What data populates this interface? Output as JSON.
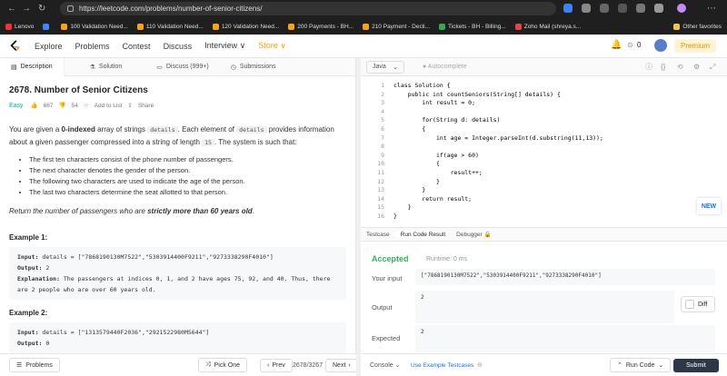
{
  "browser": {
    "url": "https://leetcode.com/problems/number-of-senior-citizens/",
    "bookmarks": [
      "Lenovo",
      "100 Validation Need...",
      "110 Validation Need...",
      "120 Validation Need...",
      "200 Payments - BH...",
      "210 Payment - Decli...",
      "Tickets - BH - Billing...",
      "Zoho Mail (shreya.s..."
    ],
    "other_favorites": "Other favorites"
  },
  "nav": {
    "items": [
      "Explore",
      "Problems",
      "Contest",
      "Discuss",
      "Interview ∨",
      "Store ∨"
    ],
    "coins": "0",
    "premium": "Premium"
  },
  "left_tabs": [
    "Description",
    "Solution",
    "Discuss (999+)",
    "Submissions"
  ],
  "problem": {
    "title": "2678. Number of Senior Citizens",
    "difficulty": "Easy",
    "likes": "667",
    "dislikes": "54",
    "add_to_list": "Add to List",
    "share": "Share",
    "p1_a": "You are given a ",
    "p1_b": "0-indexed",
    "p1_c": " array of strings ",
    "p1_d": "details",
    "p1_e": ". Each element of ",
    "p1_f": "details",
    "p1_g": " provides information about a given passenger compressed into a string of length ",
    "p1_h": "15",
    "p1_i": ". The system is such that:",
    "bullets": [
      "The first ten characters consist of the phone number of passengers.",
      "The next character denotes the gender of the person.",
      "The following two characters are used to indicate the age of the person.",
      "The last two characters determine the seat allotted to that person."
    ],
    "p2_a": "Return the number of passengers who are ",
    "p2_b": "strictly more than 60 years old",
    "p2_c": "."
  },
  "examples": [
    {
      "title": "Example 1:",
      "input_label": "Input:",
      "input": "details = [\"7868190130M7522\",\"5303914400F9211\",\"9273338290F4010\"]",
      "output_label": "Output:",
      "output": "2",
      "expl_label": "Explanation:",
      "explanation": "The passengers at indices 0, 1, and 2 have ages 75, 92, and 40. Thus, there are 2 people who are over 60 years old."
    },
    {
      "title": "Example 2:",
      "input_label": "Input:",
      "input": "details = [\"1313579440F2036\",\"2921522980M5644\"]",
      "output_label": "Output:",
      "output": "0"
    }
  ],
  "left_footer": {
    "problems": "Problems",
    "pick_one": "Pick One",
    "prev": "Prev",
    "counter": "2678/3267",
    "next": "Next"
  },
  "editor": {
    "language": "Java",
    "autocomplete": "Autocomplete",
    "lines": [
      "class Solution {",
      "    public int countSeniors(String[] details) {",
      "        int result = 0;",
      "",
      "        for(String d: details)",
      "        {",
      "            int age = Integer.parseInt(d.substring(11,13));",
      "",
      "            if(age > 60)",
      "            {",
      "                result++;",
      "            }",
      "        }",
      "        return result;",
      "    }",
      "}"
    ]
  },
  "result": {
    "tabs": [
      "Testcase",
      "Run Code Result",
      "Debugger"
    ],
    "status": "Accepted",
    "runtime": "Runtime: 0 ms",
    "your_input_label": "Your input",
    "your_input": "[\"7868190130M7522\",\"5303914400F9211\",\"9273338290F4010\"]",
    "output_label": "Output",
    "output": "2",
    "diff": "Diff",
    "expected_label": "Expected",
    "expected": "2",
    "new_badge": "NEW"
  },
  "right_footer": {
    "console": "Console",
    "use_example": "Use Example Testcases",
    "run_code": "Run Code",
    "submit": "Submit"
  },
  "colors": {
    "accent": "#ffa116",
    "easy": "#00b8a3",
    "accepted": "#2db55d",
    "submit": "#2d3748"
  }
}
